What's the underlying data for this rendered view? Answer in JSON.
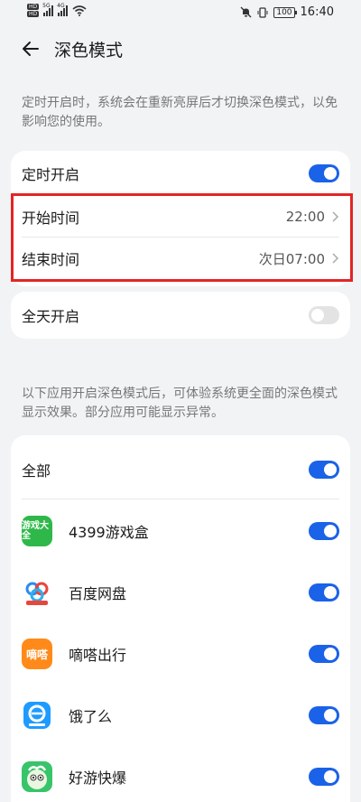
{
  "status_bar": {
    "sim_labels": [
      "HD",
      "HD"
    ],
    "signal_labels": [
      "5G",
      "4G"
    ],
    "battery": "100",
    "time": "16:40"
  },
  "header": {
    "title": "深色模式"
  },
  "schedule_desc": "定时开启时，系统会在重新亮屏后才切换深色模式，以免影响您的使用。",
  "schedule": {
    "timed_label": "定时开启",
    "timed_on": true,
    "start_label": "开始时间",
    "start_value": "22:00",
    "end_label": "结束时间",
    "end_value": "次日07:00"
  },
  "all_day": {
    "label": "全天开启",
    "on": false
  },
  "apps_desc": "以下应用开启深色模式后，可体验系统更全面的深色模式显示效果。部分应用可能显示异常。",
  "apps": {
    "all_label": "全部",
    "all_on": true,
    "items": [
      {
        "name": "4399游戏盒",
        "icon": "4399-game-box-icon",
        "icon_text": "游戏大全",
        "color": "#2fb84a",
        "on": true
      },
      {
        "name": "百度网盘",
        "icon": "baidu-netdisk-icon",
        "icon_text": "",
        "color": "#ffffff",
        "on": true
      },
      {
        "name": "嘀嗒出行",
        "icon": "dida-chuxing-icon",
        "icon_text": "嘀嗒",
        "color": "#ff8a1a",
        "on": true
      },
      {
        "name": "饿了么",
        "icon": "eleme-icon",
        "icon_text": "",
        "color": "#1e9bff",
        "on": true
      },
      {
        "name": "好游快爆",
        "icon": "haoyou-kuaibao-icon",
        "icon_text": "",
        "color": "#38c46a",
        "on": true
      }
    ]
  },
  "colors": {
    "accent": "#1a62e8",
    "highlight_box": "#e32525"
  }
}
